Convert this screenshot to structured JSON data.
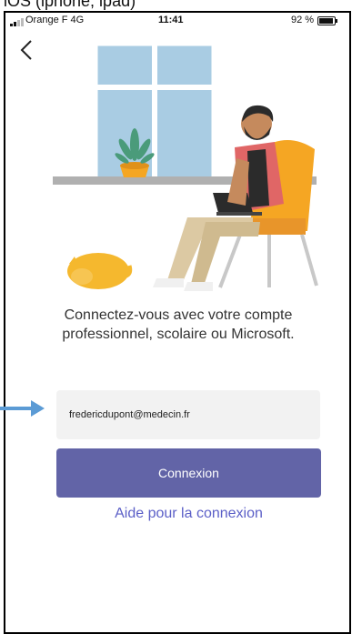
{
  "caption": "iOS (iphone, ipad)",
  "status_bar": {
    "carrier": "Orange F",
    "network": "4G",
    "time": "11:41",
    "battery": "92 %",
    "battery_level": 0.92
  },
  "icons": {
    "back": "chevron-left-icon",
    "arrow": "arrow-right-icon"
  },
  "sign_in": {
    "prompt_line1": "Connectez-vous avec votre compte",
    "prompt_line2": "professionnel, scolaire ou Microsoft.",
    "email_value": "fredericdupont@medecin.fr",
    "connect_label": "Connexion",
    "help_link": "Aide pour la connexion"
  },
  "colors": {
    "primary": "#6264a7",
    "link": "#5b5fc7",
    "field_bg": "#f2f2f2",
    "arrow": "#5b9bd5"
  }
}
